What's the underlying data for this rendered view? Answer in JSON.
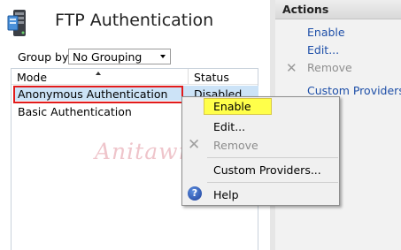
{
  "page": {
    "title": "FTP Authentication",
    "icon": "server-icon"
  },
  "toolbar": {
    "group_by_label": "Group by:",
    "group_by_value": "No Grouping"
  },
  "table": {
    "columns": [
      "Mode",
      "Status"
    ],
    "sort": {
      "column": "Mode",
      "direction": "ascending"
    },
    "rows": [
      {
        "mode": "Anonymous Authentication",
        "status": "Disabled",
        "selected": true
      },
      {
        "mode": "Basic Authentication",
        "status": ""
      }
    ]
  },
  "actions": {
    "title": "Actions",
    "items": [
      {
        "label": "Enable",
        "enabled": true
      },
      {
        "label": "Edit...",
        "enabled": true
      },
      {
        "label": "Remove",
        "enabled": false,
        "icon": "remove-x-icon"
      },
      {
        "label": "Custom Providers...",
        "enabled": true
      }
    ]
  },
  "context_menu": {
    "items": [
      {
        "label": "Enable",
        "highlighted": true
      },
      {
        "label": "Edit..."
      },
      {
        "label": "Remove",
        "enabled": false,
        "icon": "remove-x-icon"
      },
      {
        "label": "Custom Providers..."
      },
      {
        "label": "Help",
        "icon": "help-icon"
      }
    ]
  },
  "watermark": "Anitawncn",
  "colors": {
    "selection_bg": "#cce3f7",
    "highlight_border": "#e21b1b",
    "menu_highlight": "#ffff4a",
    "link": "#1e4fa8"
  }
}
